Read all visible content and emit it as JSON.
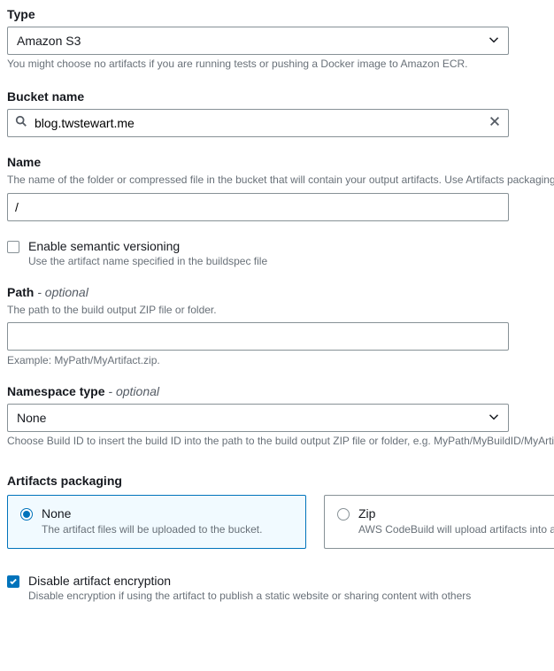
{
  "type": {
    "label": "Type",
    "value": "Amazon S3",
    "help": "You might choose no artifacts if you are running tests or pushing a Docker image to Amazon ECR."
  },
  "bucket": {
    "label": "Bucket name",
    "value": "blog.twstewart.me"
  },
  "name": {
    "label": "Name",
    "help": "The name of the folder or compressed file in the bucket that will contain your output artifacts. Use Artifacts packaging under Additional configuration to choose whether to use a folder or compressed file. If the name is not provided, defaults to project name.",
    "value": "/"
  },
  "semantic": {
    "title": "Enable semantic versioning",
    "sub": "Use the artifact name specified in the buildspec file",
    "checked": false
  },
  "path": {
    "label": "Path",
    "optional": "- optional",
    "help": "The path to the build output ZIP file or folder.",
    "value": "",
    "example": "Example: MyPath/MyArtifact.zip."
  },
  "namespace": {
    "label": "Namespace type",
    "optional": "- optional",
    "value": "None",
    "help": "Choose Build ID to insert the build ID into the path to the build output ZIP file or folder, e.g. MyPath/MyBuildID/MyArtifact.zip. Otherwise, choose None."
  },
  "packaging": {
    "label": "Artifacts packaging",
    "none": {
      "title": "None",
      "sub": "The artifact files will be uploaded to the bucket.",
      "selected": true
    },
    "zip": {
      "title": "Zip",
      "sub": "AWS CodeBuild will upload artifacts into a compressed file that is put into the specified bucket.",
      "selected": false
    }
  },
  "encryption": {
    "title": "Disable artifact encryption",
    "sub": "Disable encryption if using the artifact to publish a static website or sharing content with others",
    "checked": true
  }
}
